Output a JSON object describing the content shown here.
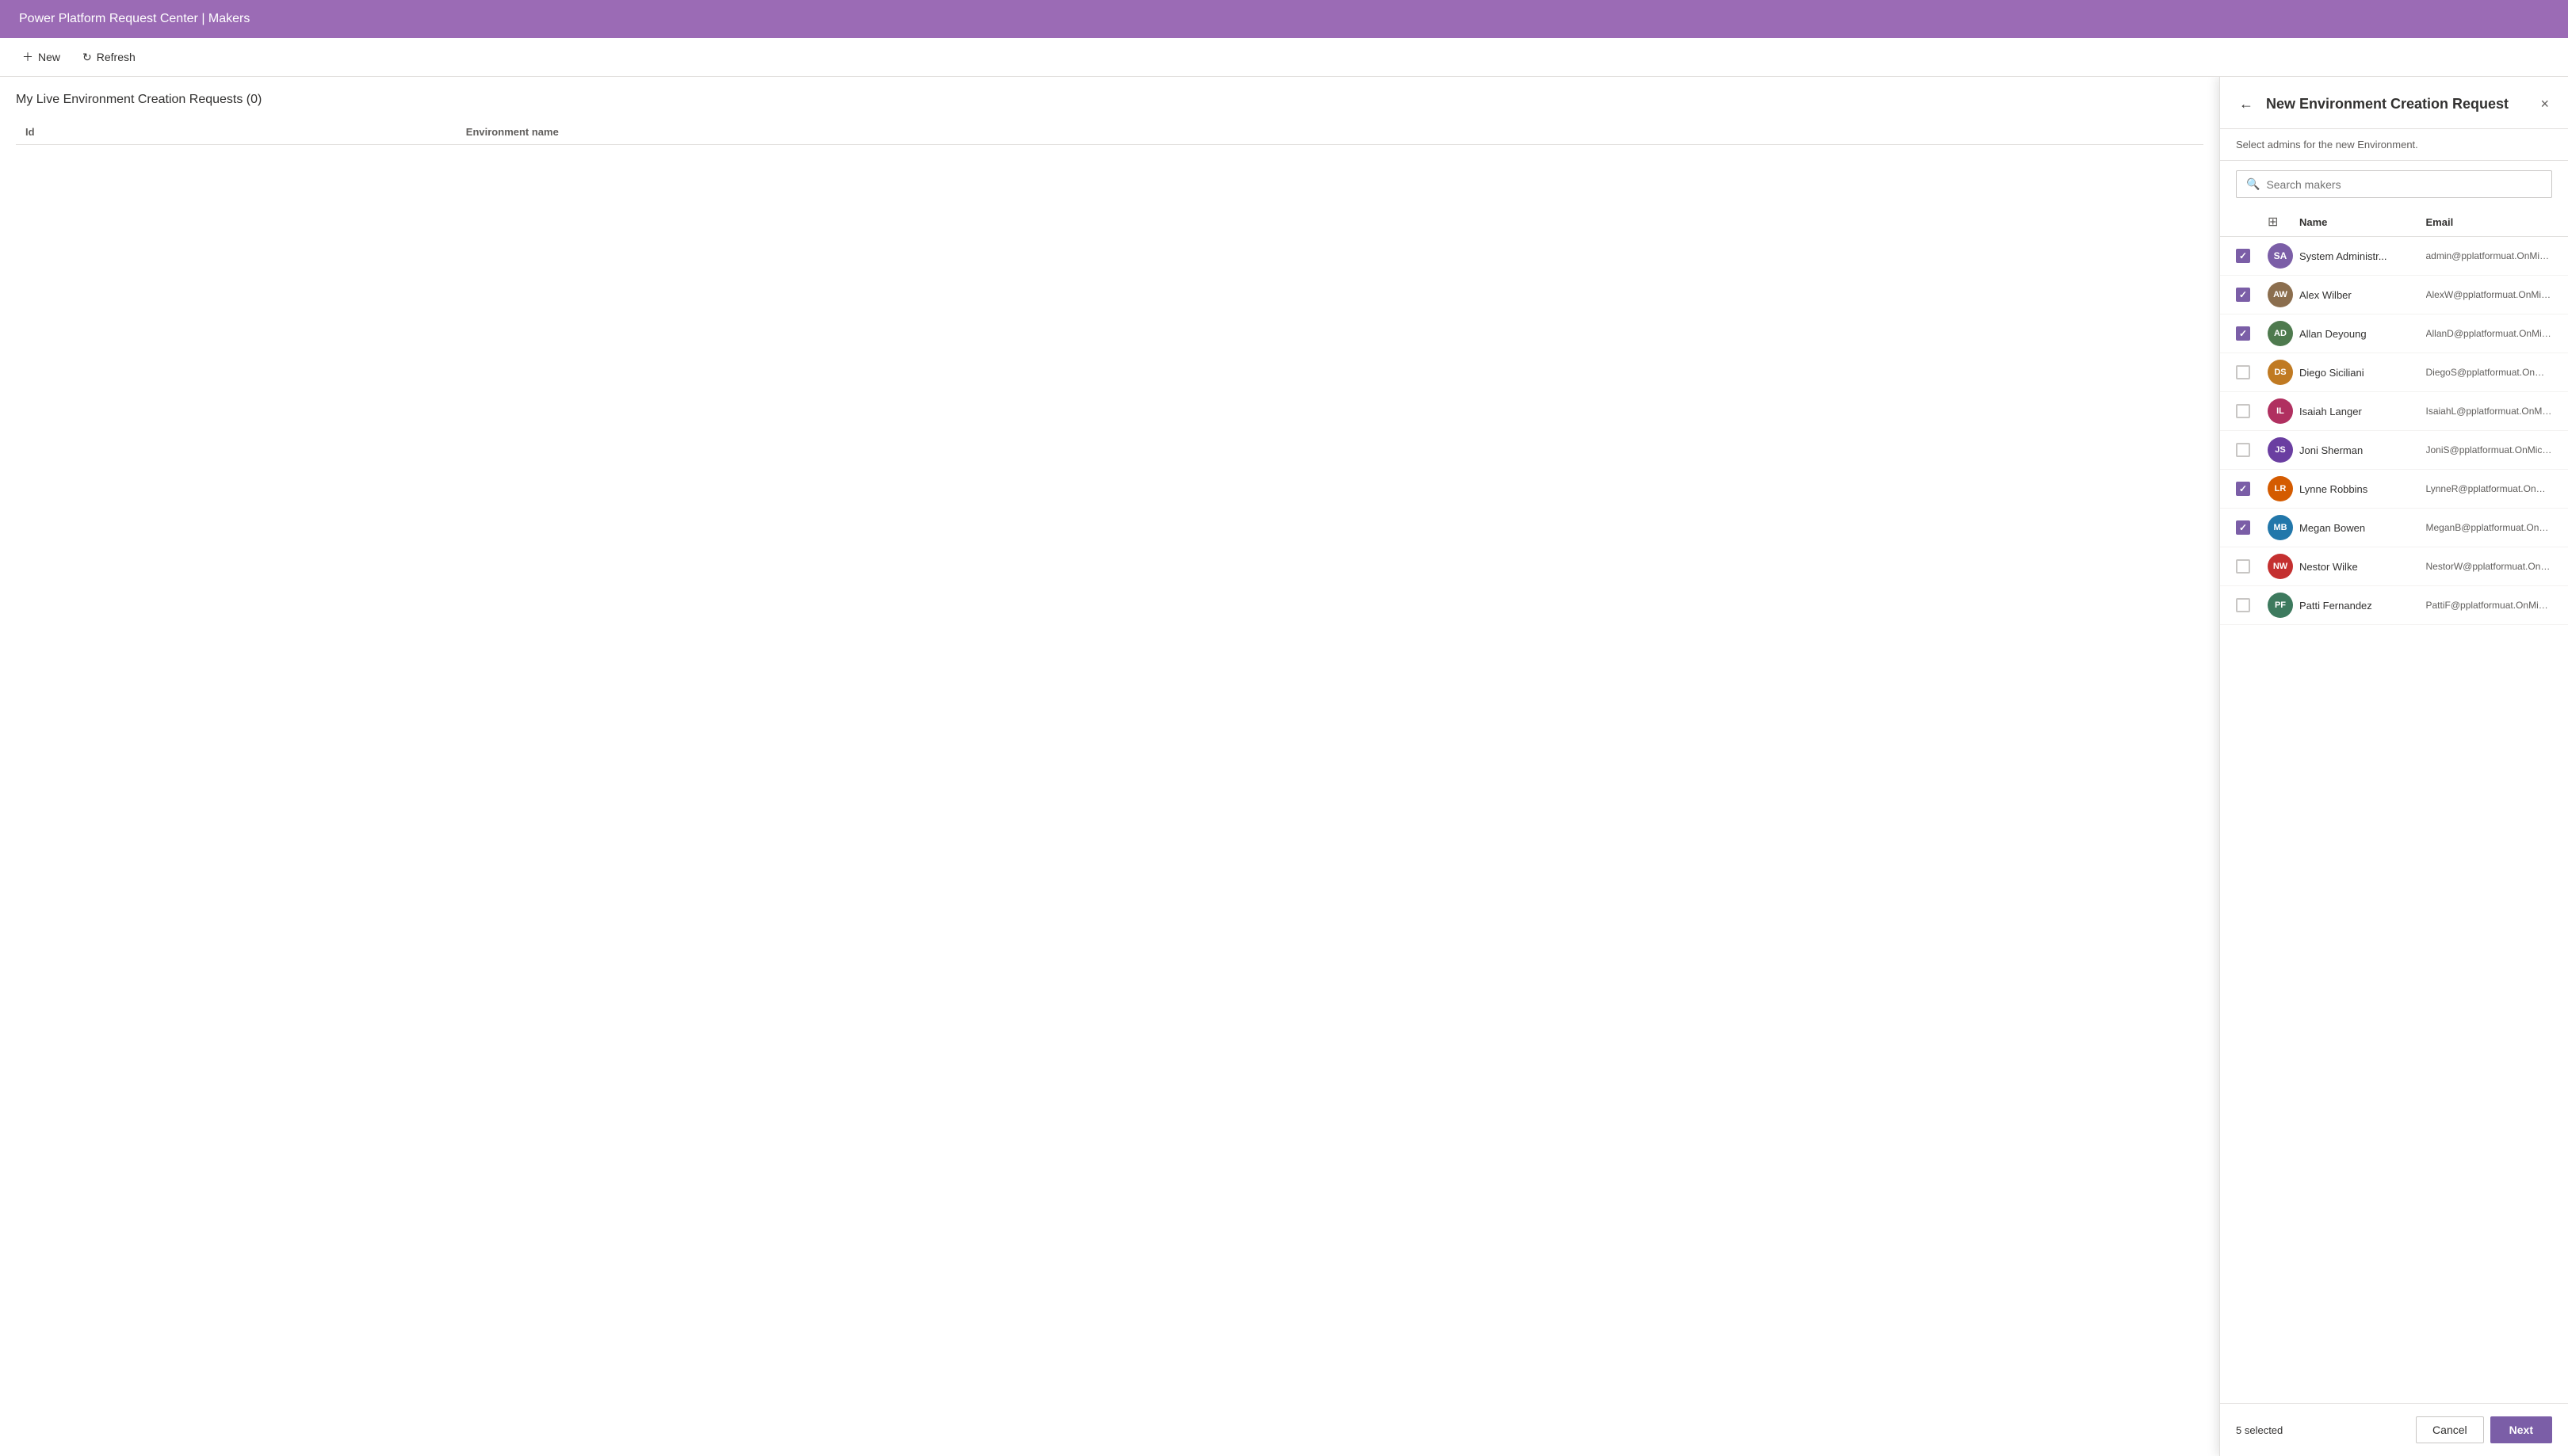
{
  "app": {
    "title": "Power Platform Request Center | Makers"
  },
  "toolbar": {
    "new_label": "New",
    "refresh_label": "Refresh"
  },
  "main": {
    "section_title": "My Live Environment Creation Requests (0)",
    "table": {
      "columns": [
        "Id",
        "Environment name"
      ],
      "rows": []
    }
  },
  "panel": {
    "title": "New Environment Creation Request",
    "subtitle": "Select admins for the new Environment.",
    "search_placeholder": "Search makers",
    "close_label": "×",
    "selected_count": "5 selected",
    "cancel_label": "Cancel",
    "next_label": "Next",
    "columns": {
      "name": "Name",
      "email": "Email"
    },
    "people": [
      {
        "id": "system-admin",
        "name": "System Administr...",
        "email": "admin@pplatformuat.OnMicrosoft.co...",
        "checked": true,
        "avatar_type": "initials",
        "initials": "SA",
        "avatar_bg": "#7b5ea7"
      },
      {
        "id": "alex-wilber",
        "name": "Alex Wilber",
        "email": "AlexW@pplatformuat.OnMicrosoft.c...",
        "checked": true,
        "avatar_type": "photo",
        "initials": "AW",
        "avatar_bg": "#5b9bd5"
      },
      {
        "id": "allan-deyoung",
        "name": "Allan Deyoung",
        "email": "AllanD@pplatformuat.OnMicrosoft.c...",
        "checked": true,
        "avatar_type": "photo",
        "initials": "AD",
        "avatar_bg": "#8b572a"
      },
      {
        "id": "diego-siciliani",
        "name": "Diego Siciliani",
        "email": "DiegoS@pplatformuat.OnMicrosoft.c...",
        "checked": false,
        "avatar_type": "photo",
        "initials": "DS",
        "avatar_bg": "#4e8b4e"
      },
      {
        "id": "isaiah-langer",
        "name": "Isaiah Langer",
        "email": "IsaiahL@pplatformuat.OnMicrosoft.c...",
        "checked": false,
        "avatar_type": "photo",
        "initials": "IL",
        "avatar_bg": "#d4a017"
      },
      {
        "id": "joni-sherman",
        "name": "Joni Sherman",
        "email": "JoniS@pplatformuat.OnMicrosoft.com",
        "checked": false,
        "avatar_type": "photo",
        "initials": "JS",
        "avatar_bg": "#c0392b"
      },
      {
        "id": "lynne-robbins",
        "name": "Lynne Robbins",
        "email": "LynneR@pplatformuat.OnMicrosoft.c...",
        "checked": true,
        "avatar_type": "photo",
        "initials": "LR",
        "avatar_bg": "#8e44ad"
      },
      {
        "id": "megan-bowen",
        "name": "Megan Bowen",
        "email": "MeganB@pplatformuat.OnMicrosoft....",
        "checked": true,
        "avatar_type": "photo",
        "initials": "MB",
        "avatar_bg": "#e67e22"
      },
      {
        "id": "nestor-wilke",
        "name": "Nestor Wilke",
        "email": "NestorW@pplatformuat.OnMicrosoft....",
        "checked": false,
        "avatar_type": "photo",
        "initials": "NW",
        "avatar_bg": "#2980b9"
      },
      {
        "id": "patti-fernandez",
        "name": "Patti Fernandez",
        "email": "PattiF@pplatformuat.OnMicrosoft.com",
        "checked": false,
        "avatar_type": "photo",
        "initials": "PF",
        "avatar_bg": "#e74c3c"
      }
    ]
  }
}
